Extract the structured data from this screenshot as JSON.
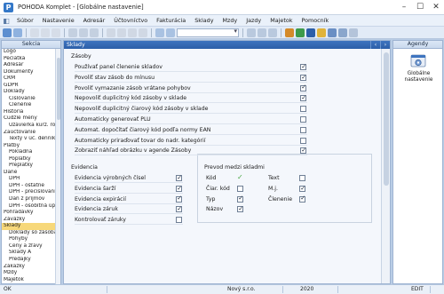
{
  "window": {
    "title": "POHODA Komplet - [Globálne nastavenie]"
  },
  "menu": [
    "Súbor",
    "Nastavenie",
    "Adresár",
    "Účtovníctvo",
    "Fakturácia",
    "Sklady",
    "Mzdy",
    "Jazdy",
    "Majetok",
    "Pomocník"
  ],
  "left_pane": {
    "title": "Sekcia",
    "items": [
      {
        "label": "Logo",
        "level": 0
      },
      {
        "label": "Pečiatka",
        "level": 0
      },
      {
        "label": "Adresár",
        "level": 0
      },
      {
        "label": "Dokumenty",
        "level": 0
      },
      {
        "label": "CRM",
        "level": 0
      },
      {
        "label": "GDPR",
        "level": 0
      },
      {
        "label": "Doklady",
        "level": 0
      },
      {
        "label": "Číslovanie",
        "level": 1
      },
      {
        "label": "Členenie",
        "level": 1
      },
      {
        "label": "História",
        "level": 0
      },
      {
        "label": "Cudzie meny",
        "level": 0
      },
      {
        "label": "Uzávierka kurz. rozdiel.",
        "level": 1
      },
      {
        "label": "Zaúčtovanie",
        "level": 0
      },
      {
        "label": "Texty v úč. denníku",
        "level": 1
      },
      {
        "label": "Platby",
        "level": 0
      },
      {
        "label": "Pokladňa",
        "level": 1
      },
      {
        "label": "Poplatky",
        "level": 1
      },
      {
        "label": "Preplatky",
        "level": 1
      },
      {
        "label": "Dane",
        "level": 0
      },
      {
        "label": "DPH",
        "level": 1
      },
      {
        "label": "DPH - ostatné",
        "level": 1
      },
      {
        "label": "DPH - prečíslovanie",
        "level": 1
      },
      {
        "label": "Daň z príjmov",
        "level": 1
      },
      {
        "label": "DPH - osobitná úprava",
        "level": 1
      },
      {
        "label": "Pohľadávky",
        "level": 0
      },
      {
        "label": "Záväzky",
        "level": 0
      },
      {
        "label": "Sklady",
        "level": 0,
        "selected": true
      },
      {
        "label": "Doklady so zásobami",
        "level": 1
      },
      {
        "label": "Pohyby",
        "level": 1
      },
      {
        "label": "Ceny a zľavy",
        "level": 1
      },
      {
        "label": "Sklady A",
        "level": 1
      },
      {
        "label": "Predajky",
        "level": 1
      },
      {
        "label": "Zákazky",
        "level": 0
      },
      {
        "label": "Mzdy",
        "level": 0
      },
      {
        "label": "Majetok",
        "level": 0
      }
    ]
  },
  "content": {
    "tab": "Sklady",
    "zasoby": {
      "title": "Zásoby",
      "items": [
        {
          "label": "Používať panel členenie skladov",
          "checked": true
        },
        {
          "label": "Povoliť stav zásob do mínusu",
          "checked": true
        },
        {
          "label": "Povoliť vymazanie zásob vrátane pohybov",
          "checked": true
        },
        {
          "label": "Nepovoliť duplicitný kód zásoby v sklade",
          "checked": true
        },
        {
          "label": "Nepovoliť duplicitný čiarový kód zásoby v sklade",
          "checked": false
        },
        {
          "label": "Automaticky generovať PLU",
          "checked": false
        },
        {
          "label": "Automat. dopočítať čiarový kód podľa normy EAN",
          "checked": false
        },
        {
          "label": "Automaticky priraďovať tovar do nadr. kategórií",
          "checked": false
        },
        {
          "label": "Zobraziť náhľad obrázku v agende Zásoby",
          "checked": true
        }
      ]
    },
    "evidencia": {
      "title": "Evidencia",
      "items": [
        {
          "label": "Evidencia výrobných čísel",
          "checked": true
        },
        {
          "label": "Evidencia šarží",
          "checked": true
        },
        {
          "label": "Evidencia expirácií",
          "checked": true
        },
        {
          "label": "Evidencia záruk",
          "checked": true
        },
        {
          "label": "Kontrolovať záruky",
          "checked": false
        }
      ]
    },
    "prevod": {
      "title": "Prevod medzi skladmi",
      "left": [
        {
          "label": "Kód",
          "mark": "green"
        },
        {
          "label": "Čiar. kód",
          "checked": false
        },
        {
          "label": "Typ",
          "checked": true
        },
        {
          "label": "Názov",
          "checked": true
        }
      ],
      "right": [
        {
          "label": "Text",
          "checked": false
        },
        {
          "label": "M.j.",
          "checked": true
        },
        {
          "label": "Členenie",
          "checked": true
        }
      ]
    }
  },
  "right_pane": {
    "title": "Agendy",
    "agenda_label": "Globálne nastavenie"
  },
  "status": {
    "mode": "OK",
    "company": "Nový s.r.o.",
    "year": "2020",
    "edit": "EDIT"
  },
  "colors": {
    "accent": "#2c5ea8",
    "selected": "#f7d87a",
    "green": "#4aa846"
  }
}
